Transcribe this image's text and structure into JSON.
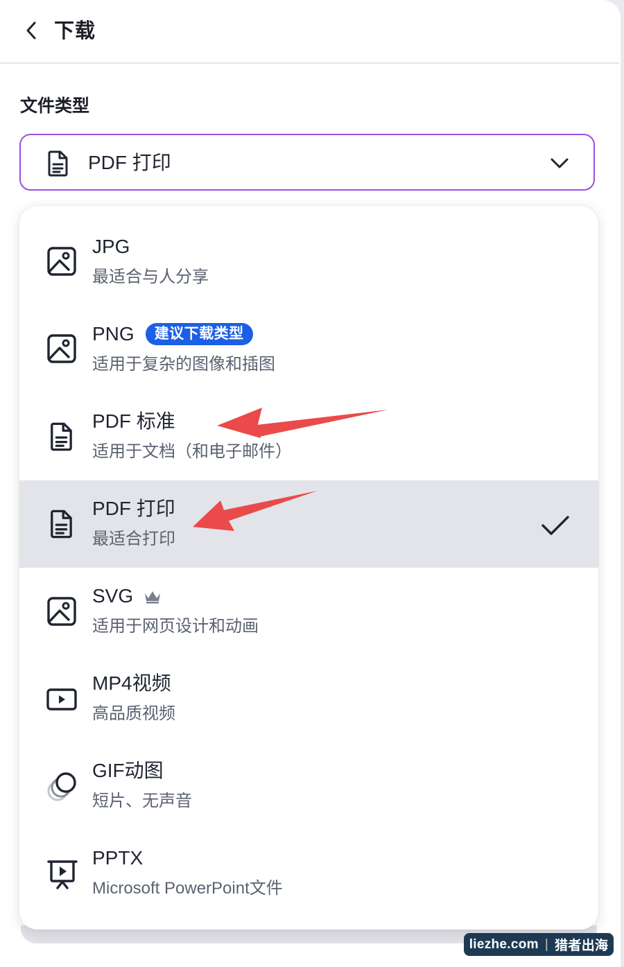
{
  "header": {
    "title": "下载"
  },
  "file_type": {
    "label": "文件类型",
    "selected_value": "PDF 打印"
  },
  "options": [
    {
      "title": "JPG",
      "description": "最适合与人分享",
      "icon": "image-icon"
    },
    {
      "title": "PNG",
      "badge": "建议下载类型",
      "description": "适用于复杂的图像和插图",
      "icon": "image-icon"
    },
    {
      "title": "PDF 标准",
      "description": "适用于文档（和电子邮件）",
      "icon": "document-icon"
    },
    {
      "title": "PDF 打印",
      "description": "最适合打印",
      "icon": "document-icon",
      "selected": true
    },
    {
      "title": "SVG",
      "description": "适用于网页设计和动画",
      "icon": "image-icon",
      "premium": true
    },
    {
      "title": "MP4视频",
      "description": "高品质视频",
      "icon": "video-play-icon"
    },
    {
      "title": "GIF动图",
      "description": "短片、无声音",
      "icon": "gif-circles-icon"
    },
    {
      "title": "PPTX",
      "description": "Microsoft PowerPoint文件",
      "icon": "presentation-icon"
    }
  ],
  "watermark": {
    "site": "liezhe.com",
    "name": "猎者出海"
  },
  "colors": {
    "select_border": "#9a4fe0",
    "badge": "#1b5fe6",
    "selected_row": "#e3e4e9",
    "arrow": "#ea4a4a"
  }
}
